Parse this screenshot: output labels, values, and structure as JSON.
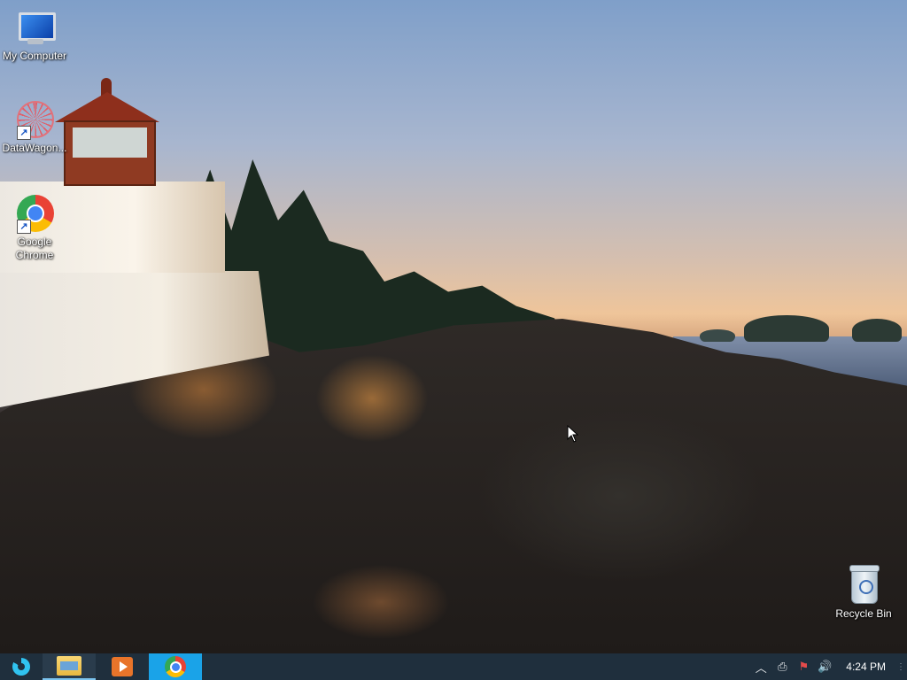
{
  "desktop": {
    "icons": [
      {
        "label": "My Computer",
        "icon": "computer-icon"
      },
      {
        "label": "DataWagon...",
        "icon": "datawagon-icon"
      },
      {
        "label": "Google\nChrome",
        "icon": "chrome-icon"
      },
      {
        "label": "Recycle Bin",
        "icon": "recycle-bin-icon"
      }
    ],
    "shortcut_glyph": "↗"
  },
  "taskbar": {
    "items": [
      {
        "icon": "start-icon",
        "state": "idle"
      },
      {
        "icon": "file-explorer-icon",
        "state": "pinned"
      },
      {
        "icon": "media-player-icon",
        "state": "pinned"
      },
      {
        "icon": "chrome-icon",
        "state": "active"
      }
    ],
    "tray": {
      "overflow_glyph": "︿",
      "network_glyph": "⎙",
      "flag_glyph": "⚑",
      "volume_glyph": "🔊",
      "clock": "4:24 PM",
      "show_desktop_glyph": "⋮"
    },
    "colors": {
      "background": "#1f2f3d",
      "active": "#1aa3e8"
    }
  }
}
